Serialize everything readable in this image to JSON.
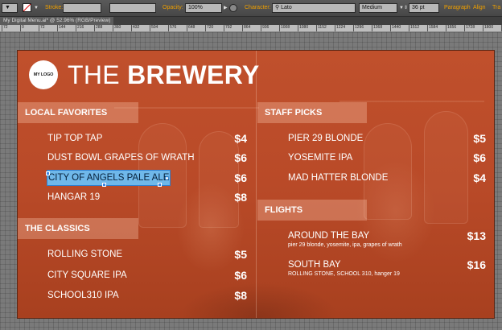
{
  "control_bar": {
    "stroke_label": "Stroke:",
    "opacity_label": "Opacity:",
    "opacity_value": "100%",
    "character_label": "Character:",
    "font_search": "Lato",
    "font_style": "Medium",
    "font_size": "36 pt",
    "paragraph_label": "Paragraph",
    "align_label": "Align",
    "transform_label": "Tra"
  },
  "document_tab": {
    "title": "My Digital Menu.ai* @ 52.96% (RGB/Preview)"
  },
  "ruler": {
    "ticks": [
      "72",
      "0",
      "72",
      "144",
      "216",
      "288",
      "360",
      "432",
      "504",
      "576",
      "648",
      "720",
      "792",
      "864",
      "936",
      "1008",
      "1080",
      "1152",
      "1224",
      "1296",
      "1368",
      "1440",
      "1512",
      "1584",
      "1656",
      "1728",
      "1800",
      "1872"
    ]
  },
  "menu": {
    "logo_text": "MY LOGO",
    "title_light": "THE ",
    "title_bold": "BREWERY",
    "local_favorites": {
      "heading": "LOCAL FAVORITES",
      "items": [
        {
          "name": "TIP TOP TAP",
          "price": "$4"
        },
        {
          "name": "DUST BOWL GRAPES OF WRATH",
          "price": "$6"
        },
        {
          "name": "CITY OF ANGELS PALE ALE",
          "price": "$6"
        },
        {
          "name": "HANGAR 19",
          "price": "$8"
        }
      ]
    },
    "the_classics": {
      "heading": "THE CLASSICS",
      "items": [
        {
          "name": "ROLLING STONE",
          "price": "$5"
        },
        {
          "name": "CITY SQUARE IPA",
          "price": "$6"
        },
        {
          "name": "SCHOOL310 IPA",
          "price": "$8"
        }
      ]
    },
    "staff_picks": {
      "heading": "STAFF PICKS",
      "items": [
        {
          "name": "PIER 29 BLONDE",
          "price": "$5"
        },
        {
          "name": "YOSEMITE IPA",
          "price": "$6"
        },
        {
          "name": "MAD HATTER BLONDE",
          "price": "$4"
        }
      ]
    },
    "flights": {
      "heading": "FLIGHTS",
      "items": [
        {
          "name": "AROUND THE BAY",
          "price": "$13",
          "detail": "pier 29 blonde, yosemite, ipa, grapes of wrath"
        },
        {
          "name": "SOUTH BAY",
          "price": "$16",
          "detail": "ROLLING STONE, SCHOOL 310, hanger 19"
        }
      ]
    }
  },
  "colors": {
    "accent": "#f0a000",
    "artboard": "#b94a28",
    "selection": "#6fb8ea"
  }
}
